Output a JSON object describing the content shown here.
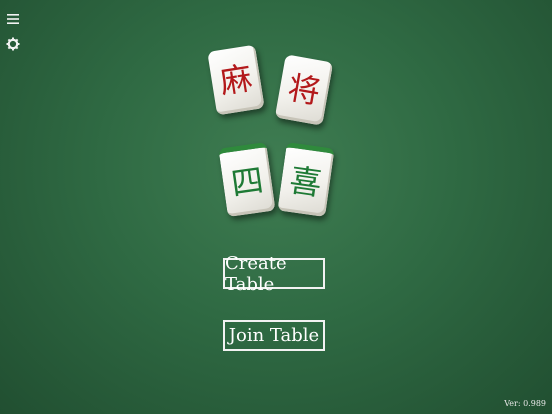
{
  "tiles": [
    {
      "char": "麻",
      "color": "#b3191b"
    },
    {
      "char": "将",
      "color": "#b3191b"
    },
    {
      "char": "四",
      "color": "#1e7a35"
    },
    {
      "char": "喜",
      "color": "#1e7a35"
    }
  ],
  "buttons": {
    "create_table": "Create Table",
    "join_table": "Join Table"
  },
  "version": "Ver: 0.989",
  "colors": {
    "felt": "#2f6a43",
    "tile_red": "#b3191b",
    "tile_green": "#1e7a35"
  },
  "icons": {
    "menu": "menu-icon",
    "settings": "gear-icon"
  }
}
